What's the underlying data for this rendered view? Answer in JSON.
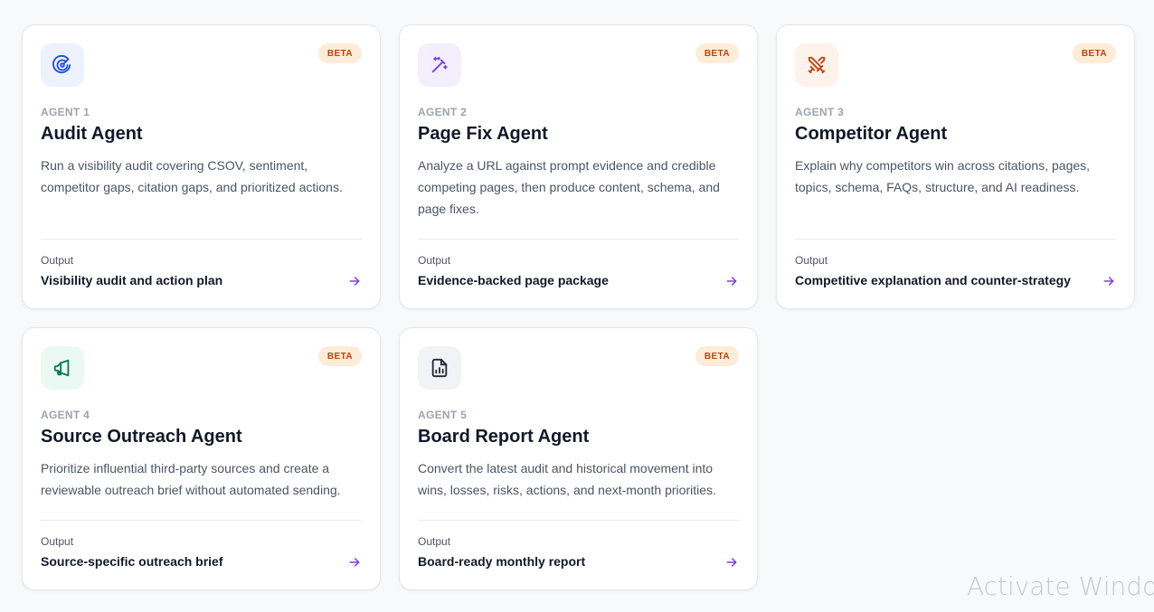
{
  "colors": {
    "badge_bg": "#fdecd8",
    "badge_text": "#c2410c",
    "arrow": "#7c3aed"
  },
  "agents": [
    {
      "number": "AGENT 1",
      "title": "Audit Agent",
      "badge": "BETA",
      "icon": "radar-target-icon",
      "icon_color": "#1d4ed8",
      "icon_bg": "#eef2ff",
      "description": "Run a visibility audit covering CSOV, sentiment, competitor gaps, citation gaps, and prioritized actions.",
      "output_label": "Output",
      "output_value": "Visibility audit and action plan"
    },
    {
      "number": "AGENT 2",
      "title": "Page Fix Agent",
      "badge": "BETA",
      "icon": "magic-wand-icon",
      "icon_color": "#7c3aed",
      "icon_bg": "#f3efff",
      "description": "Analyze a URL against prompt evidence and credible competing pages, then produce content, schema, and page fixes.",
      "output_label": "Output",
      "output_value": "Evidence-backed page package"
    },
    {
      "number": "AGENT 3",
      "title": "Competitor Agent",
      "badge": "BETA",
      "icon": "crossed-swords-icon",
      "icon_color": "#c2410c",
      "icon_bg": "#fdf3ea",
      "description": "Explain why competitors win across citations, pages, topics, schema, FAQs, structure, and AI readiness.",
      "output_label": "Output",
      "output_value": "Competitive explanation and counter-strategy"
    },
    {
      "number": "AGENT 4",
      "title": "Source Outreach Agent",
      "badge": "BETA",
      "icon": "megaphone-icon",
      "icon_color": "#047857",
      "icon_bg": "#eafaf3",
      "description": "Prioritize influential third-party sources and create a reviewable outreach brief without automated sending.",
      "output_label": "Output",
      "output_value": "Source-specific outreach brief"
    },
    {
      "number": "AGENT 5",
      "title": "Board Report Agent",
      "badge": "BETA",
      "icon": "report-chart-icon",
      "icon_color": "#1f2937",
      "icon_bg": "#f1f3f6",
      "description": "Convert the latest audit and historical movement into wins, losses, risks, actions, and next-month priorities.",
      "output_label": "Output",
      "output_value": "Board-ready monthly report"
    }
  ],
  "watermark": "Activate Windows"
}
